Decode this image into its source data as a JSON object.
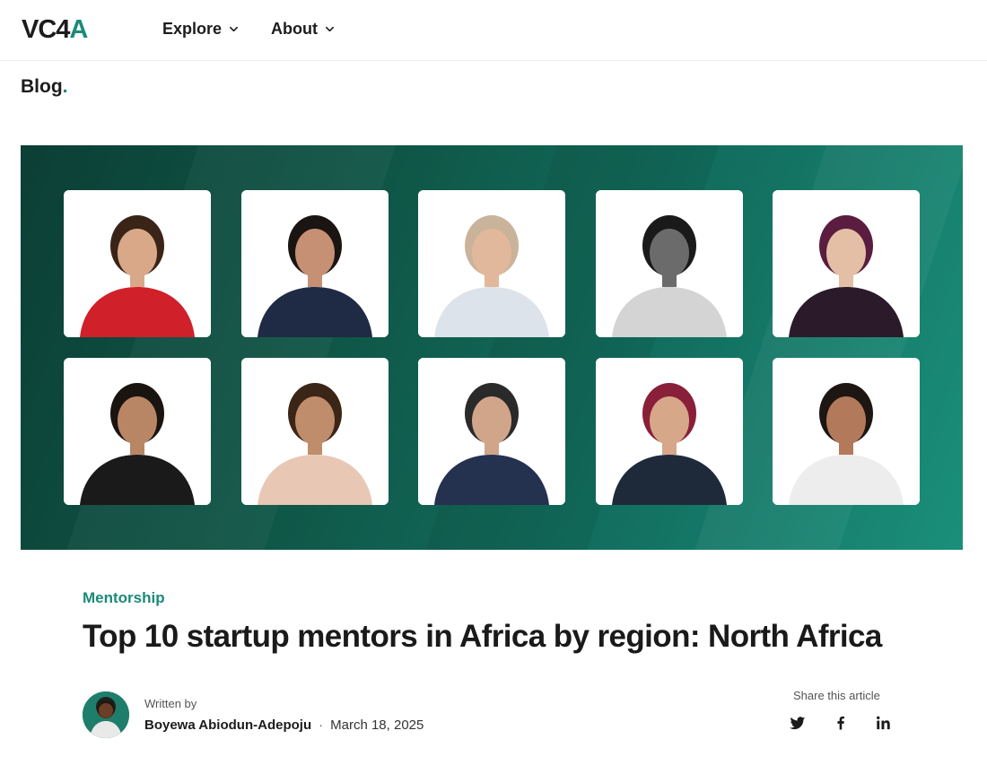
{
  "header": {
    "logo_main": "VC4",
    "logo_accent": "A",
    "nav": [
      {
        "label": "Explore",
        "icon": "chevron-down-icon"
      },
      {
        "label": "About",
        "icon": "chevron-down-icon"
      }
    ]
  },
  "blog": {
    "label": "Blog",
    "dot": "."
  },
  "hero": {
    "background_colors": [
      "#0c3f35",
      "#1a8f7a"
    ],
    "photos": [
      {
        "clothing": "#d0202a",
        "hair": "#3a2418",
        "skin": "#d9a888",
        "bg": "#ffffff"
      },
      {
        "clothing": "#1f2a44",
        "hair": "#1a1512",
        "skin": "#c69074",
        "bg": "#ffffff"
      },
      {
        "clothing": "#dde3ea",
        "hair": "#c9b39a",
        "skin": "#e2b89c",
        "bg": "#ffffff"
      },
      {
        "clothing": "#d4d4d4",
        "hair": "#1a1a1a",
        "skin": "#6b6b6b",
        "bg": "#ffffff"
      },
      {
        "clothing": "#2a1a2a",
        "hair": "#5a1d3f",
        "skin": "#e4bfa5",
        "bg": "#ffffff"
      },
      {
        "clothing": "#1a1a1a",
        "hair": "#1a1410",
        "skin": "#b98665",
        "bg": "#ffffff"
      },
      {
        "clothing": "#e8c7b4",
        "hair": "#3b2516",
        "skin": "#c08d6c",
        "bg": "#ffffff"
      },
      {
        "clothing": "#24314f",
        "hair": "#2a2a2a",
        "skin": "#d0a58a",
        "bg": "#ffffff"
      },
      {
        "clothing": "#1e2a3a",
        "hair": "#8a1f3a",
        "skin": "#d6a788",
        "bg": "#ffffff"
      },
      {
        "clothing": "#ededed",
        "hair": "#1d1612",
        "skin": "#b27a5a",
        "bg": "#ffffff"
      }
    ]
  },
  "article": {
    "category": "Mentorship",
    "title": "Top 10 startup mentors in Africa by region: North Africa",
    "written_by": "Written by",
    "author": "Boyewa Abiodun-Adepoju",
    "separator": "·",
    "date": "March 18, 2025"
  },
  "share": {
    "label": "Share this article",
    "icons": [
      "twitter-icon",
      "facebook-icon",
      "linkedin-icon"
    ]
  },
  "colors": {
    "accent": "#1b8a78",
    "text": "#1a1a1a"
  }
}
